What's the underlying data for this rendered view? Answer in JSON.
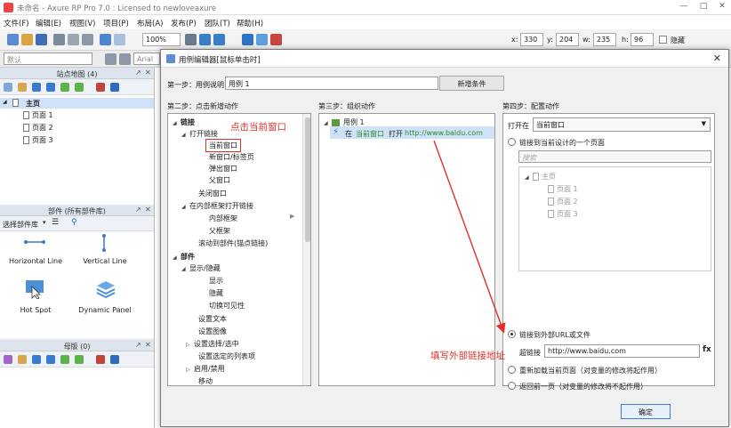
{
  "window": {
    "title": "未命名 - Axure RP Pro 7.0 : Licensed to newloveaxure"
  },
  "menu": [
    "文件(F)",
    "编辑(E)",
    "视图(V)",
    "项目(P)",
    "布局(A)",
    "发布(P)",
    "团队(T)",
    "帮助(H)"
  ],
  "toolbar": {
    "zoom": "100%",
    "x_label": "x:",
    "x_value": "330",
    "y_label": "y:",
    "y_value": "204",
    "w_label": "w:",
    "w_value": "235",
    "h_label": "h:",
    "h_value": "96",
    "hidden_label": "隐藏",
    "style_default": "默认",
    "font_name": "Arial"
  },
  "sitemap": {
    "title": "站点地图 (4)",
    "items": [
      {
        "label": "主页",
        "level": 0
      },
      {
        "label": "页面 1",
        "level": 1
      },
      {
        "label": "页面 2",
        "level": 1
      },
      {
        "label": "页面 3",
        "level": 1
      }
    ]
  },
  "widgets": {
    "title": "部件 (所有部件库)",
    "select_label": "选择部件库",
    "items": [
      "Horizontal Line",
      "Vertical Line",
      "Hot Spot",
      "Dynamic Panel"
    ]
  },
  "masters": {
    "title": "母版 (0)"
  },
  "dialog": {
    "title": "用例编辑器[鼠标单击时]",
    "step1_label": "第一步：用例说明",
    "step1_value": "用例 1",
    "add_condition": "新增条件",
    "step2_label": "第二步：点击新增动作",
    "step3_label": "第三步：组织动作",
    "step4_label": "第四步：配置动作",
    "actions": [
      {
        "label": "链接",
        "level": 0,
        "bold": true
      },
      {
        "label": "打开链接",
        "level": 1
      },
      {
        "label": "当前窗口",
        "level": 2
      },
      {
        "label": "新窗口/标签页",
        "level": 2
      },
      {
        "label": "弹出窗口",
        "level": 2
      },
      {
        "label": "父窗口",
        "level": 2
      },
      {
        "label": "关闭窗口",
        "level": 1
      },
      {
        "label": "在内部框架打开链接",
        "level": 1
      },
      {
        "label": "内部框架",
        "level": 2
      },
      {
        "label": "父框架",
        "level": 2
      },
      {
        "label": "滚动到部件(锚点链接)",
        "level": 1
      },
      {
        "label": "部件",
        "level": 0,
        "bold": true
      },
      {
        "label": "显示/隐藏",
        "level": 1
      },
      {
        "label": "显示",
        "level": 2
      },
      {
        "label": "隐藏",
        "level": 2
      },
      {
        "label": "切换可见性",
        "level": 2
      },
      {
        "label": "设置文本",
        "level": 1
      },
      {
        "label": "设置图像",
        "level": 1
      },
      {
        "label": "设置选择/选中",
        "level": 1
      },
      {
        "label": "设置选定的列表项",
        "level": 1
      },
      {
        "label": "启用/禁用",
        "level": 1
      },
      {
        "label": "移动",
        "level": 1
      }
    ],
    "organize": {
      "case_label": "用例 1",
      "action_prefix": "在",
      "action_target": "当前窗口",
      "action_verb": "打开",
      "action_url": "http://www.baidu.com"
    },
    "config": {
      "open_in_label": "打开在",
      "open_in_value": "当前窗口",
      "link_page_label": "链接到当前设计的一个页面",
      "search_placeholder": "搜索",
      "pages": [
        {
          "label": "主页",
          "level": 0
        },
        {
          "label": "页面 1",
          "level": 1
        },
        {
          "label": "页面 2",
          "level": 1
        },
        {
          "label": "页面 3",
          "level": 1
        }
      ],
      "link_url_label": "链接到外部URL或文件",
      "hyperlink_label": "超链接",
      "hyperlink_value": "http://www.baidu.com",
      "fx_label": "fx",
      "reload_label": "重新加载当前页面（对变量的修改将起作用）",
      "back_label": "返回前一页（对变量的修改将不起作用）"
    },
    "ok_button": "确定"
  },
  "annotations": {
    "click_current": "点击当前窗口",
    "fill_url": "填写外部链接地址"
  }
}
